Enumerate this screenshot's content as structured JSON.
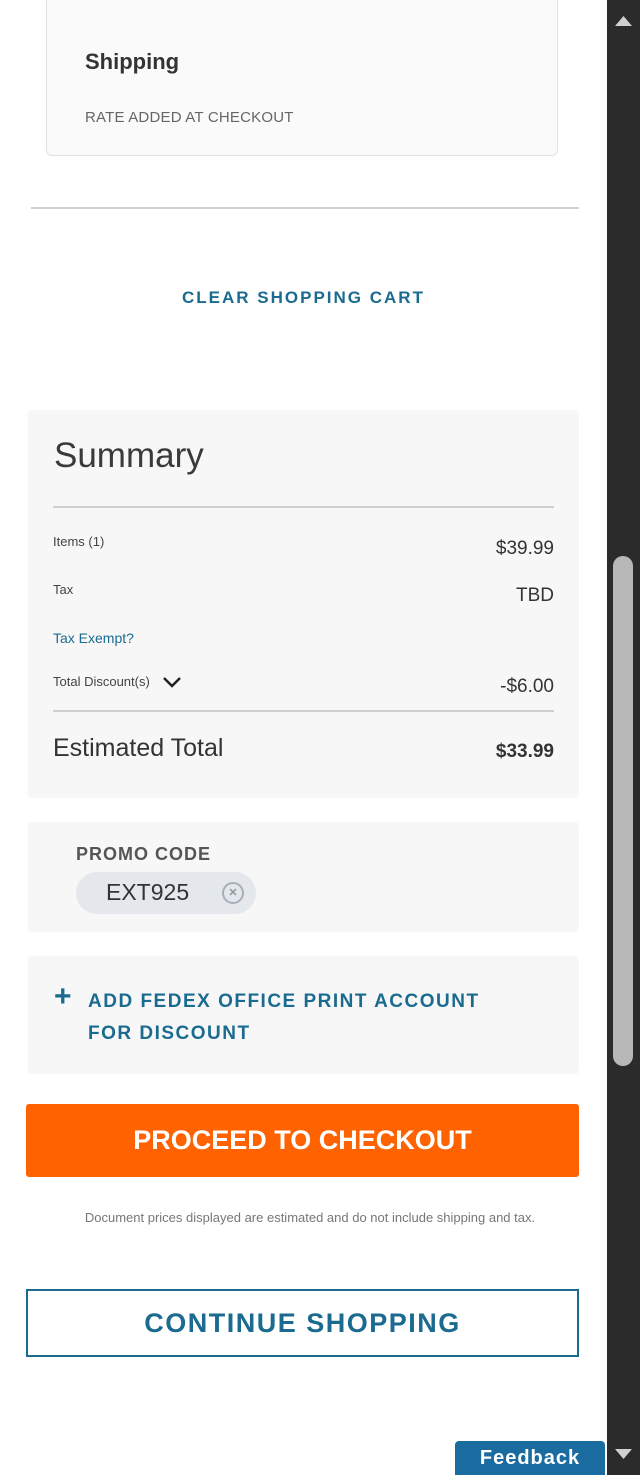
{
  "shipping": {
    "title": "Shipping",
    "rate_text": "RATE ADDED AT CHECKOUT",
    "icon": "shipping-icon"
  },
  "cart": {
    "clear_label": "CLEAR SHOPPING CART"
  },
  "summary": {
    "title": "Summary",
    "items_label": "Items (1)",
    "items_value": "$39.99",
    "tax_label": "Tax",
    "tax_value": "TBD",
    "tax_exempt_label": "Tax Exempt?",
    "discount_label": "Total Discount(s)",
    "discount_value": "-$6.00",
    "estimated_total_label": "Estimated Total",
    "estimated_total_value": "$33.99"
  },
  "promo": {
    "label": "PROMO CODE",
    "code": "EXT925"
  },
  "account": {
    "add_label": "ADD FEDEX OFFICE PRINT ACCOUNT FOR DISCOUNT"
  },
  "actions": {
    "checkout_label": "PROCEED TO CHECKOUT",
    "disclaimer": "Document prices displayed are estimated and do not include shipping and tax.",
    "continue_label": "CONTINUE SHOPPING"
  },
  "feedback": {
    "label": "Feedback"
  },
  "colors": {
    "accent_blue": "#1a6b8f",
    "checkout_orange": "#ff6200",
    "fedex_purple": "#4d148c"
  }
}
